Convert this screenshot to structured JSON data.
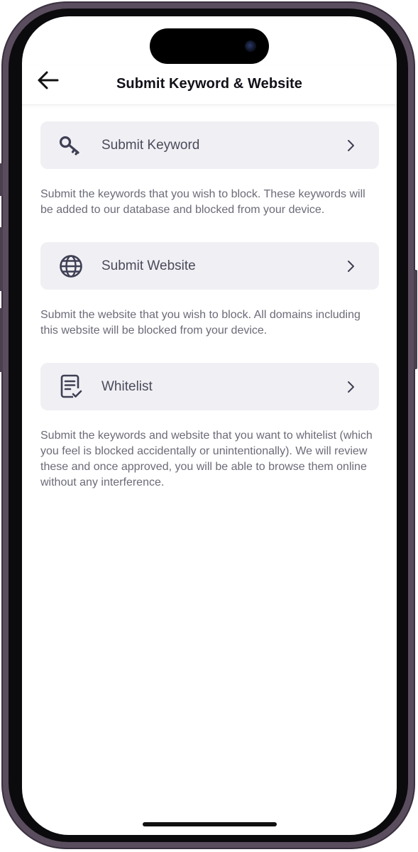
{
  "header": {
    "title": "Submit Keyword & Website"
  },
  "options": [
    {
      "label": "Submit Keyword",
      "icon": "key-icon",
      "description": "Submit the keywords that you wish to block. These keywords will be added to our database and blocked from your device."
    },
    {
      "label": "Submit Website",
      "icon": "globe-icon",
      "description": "Submit the website that you wish to block. All domains including this website will be blocked from your device."
    },
    {
      "label": "Whitelist",
      "icon": "checklist-document-icon",
      "description": "Submit the keywords and website that you want to whitelist (which you feel is blocked accidentally or unintentionally). We will review these and once approved, you will be able to browse them online without any interference."
    }
  ],
  "colors": {
    "row_background": "#f0f0f4",
    "label_text": "#4a4a5c",
    "description_text": "#6b6b78",
    "title_text": "#111118",
    "device_frame": "#5a4d5e"
  }
}
